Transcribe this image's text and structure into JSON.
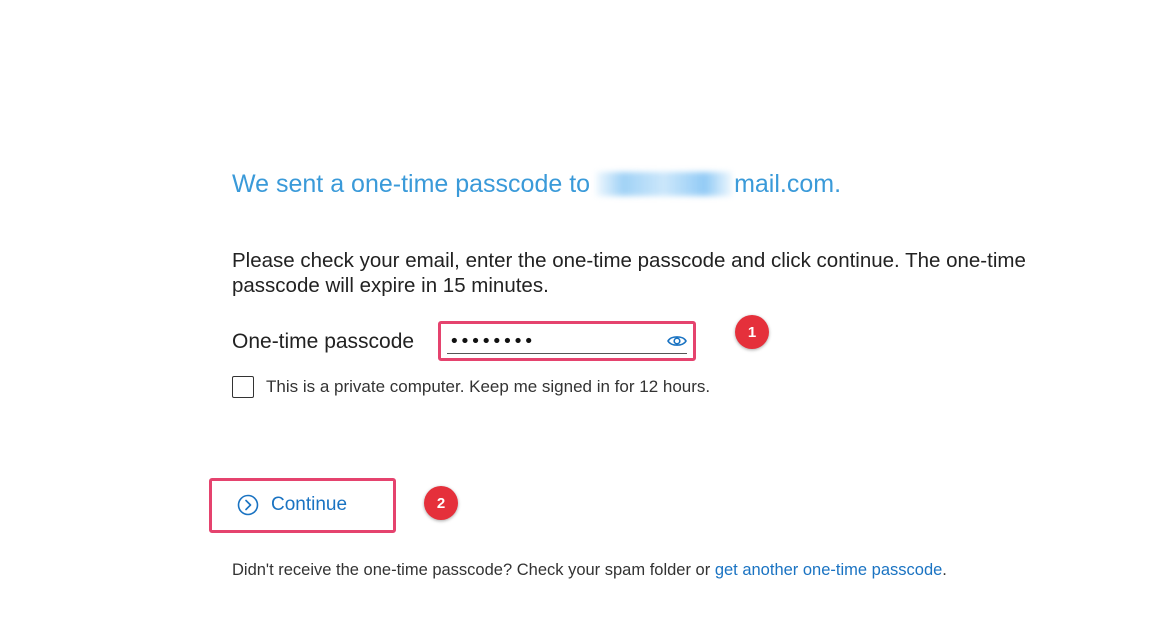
{
  "heading": {
    "prefix": "We sent a one-time passcode to",
    "email_visible": "mail.com."
  },
  "intro_text": "Please check your email, enter the one-time passcode and click continue. The one-time passcode will expire in 15 minutes.",
  "otp": {
    "label": "One-time passcode",
    "value": "••••••••",
    "icon": "eye-icon"
  },
  "remember": {
    "label": "This is a private computer. Keep me signed in for 12 hours.",
    "checked": false
  },
  "continue": {
    "label": "Continue",
    "icon": "chevron-circle-right-icon"
  },
  "footer": {
    "text": "Didn't receive the one-time passcode? Check your spam folder or",
    "link": "get another one-time passcode",
    "suffix": "."
  },
  "annotations": [
    {
      "number": "1",
      "color": "#e5303b"
    },
    {
      "number": "2",
      "color": "#e5303b"
    }
  ],
  "colors": {
    "heading": "#3a9ad9",
    "link": "#1a73c2",
    "highlight_frame": "#e5436e"
  }
}
